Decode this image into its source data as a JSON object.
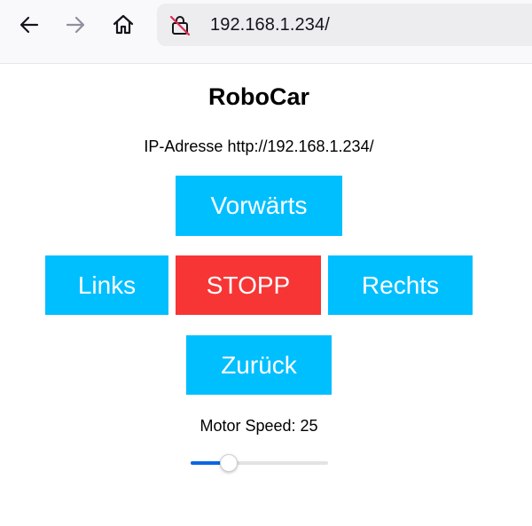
{
  "browser": {
    "url": "192.168.1.234/",
    "icons": {
      "back": "back-arrow-icon",
      "forward": "forward-arrow-icon",
      "home": "home-icon",
      "lock": "insecure-lock-icon"
    }
  },
  "page": {
    "title": "RoboCar",
    "ip_line": "IP-Adresse http://192.168.1.234/"
  },
  "controls": {
    "forward": "Vorwärts",
    "left": "Links",
    "stop": "STOPP",
    "right": "Rechts",
    "backward": "Zurück"
  },
  "speed": {
    "label": "Motor Speed: 25",
    "fraction": 0.28
  },
  "colors": {
    "button_blue": "#00bfff",
    "stop_red": "#f73535",
    "slider_accent": "#0b66e4"
  }
}
